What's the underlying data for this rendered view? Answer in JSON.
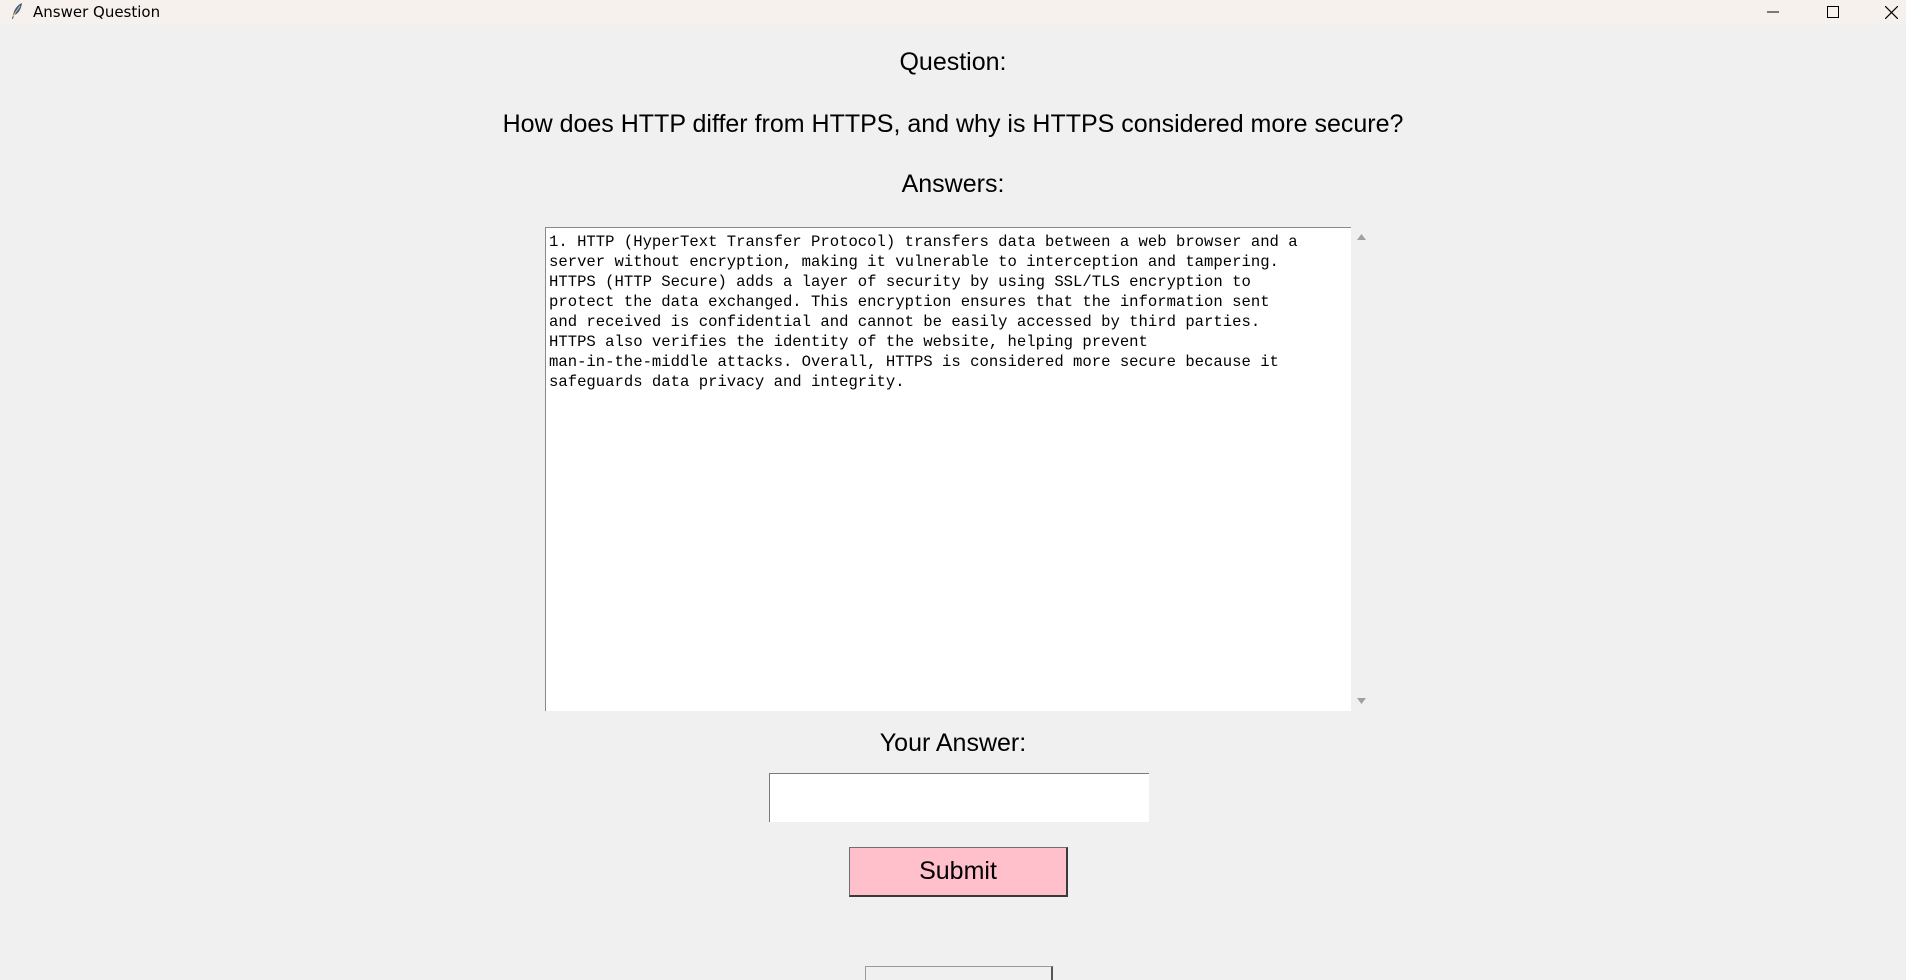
{
  "window": {
    "title": "Answer Question",
    "icon": "feather-icon",
    "controls": [
      "minimize-icon",
      "maximize-icon",
      "close-icon"
    ]
  },
  "labels": {
    "question": "Question:",
    "answers": "Answers:",
    "your_answer": "Your Answer:"
  },
  "question_text": "How does HTTP differ from HTTPS, and why is HTTPS considered more secure?",
  "answers_text": "1. HTTP (HyperText Transfer Protocol) transfers data between a web browser and a\nserver without encryption, making it vulnerable to interception and tampering.\nHTTPS (HTTP Secure) adds a layer of security by using SSL/TLS encryption to\nprotect the data exchanged. This encryption ensures that the information sent\nand received is confidential and cannot be easily accessed by third parties.\nHTTPS also verifies the identity of the website, helping prevent\nman-in-the-middle attacks. Overall, HTTPS is considered more secure because it\nsafeguards data privacy and integrity.",
  "answer_input": {
    "value": "",
    "placeholder": ""
  },
  "submit_label": "Submit",
  "colors": {
    "background": "#f0f0f0",
    "titlebar": "#f7f1ee",
    "submit_button": "#ffc0cb",
    "text_area": "#ffffff"
  }
}
